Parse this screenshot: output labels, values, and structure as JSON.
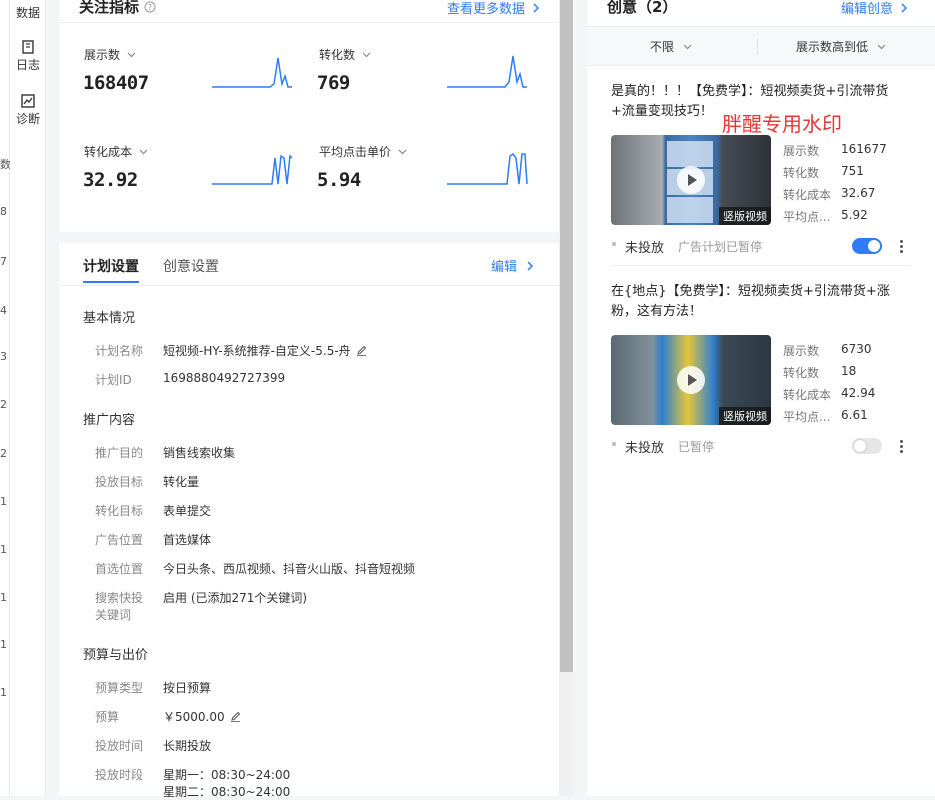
{
  "left_edge_numbers": [
    "数",
    "8",
    "7",
    "4",
    "3",
    "2",
    "2",
    "1",
    "1",
    "1",
    "1",
    "1"
  ],
  "rail": {
    "items": [
      {
        "label": "数据",
        "icon": "data-icon"
      },
      {
        "label": "日志",
        "icon": "log-icon"
      },
      {
        "label": "诊断",
        "icon": "diagnosis-icon"
      }
    ]
  },
  "metrics": {
    "title": "关注指标",
    "more_link": "查看更多数据",
    "items": [
      {
        "label": "展示数",
        "value": "168407"
      },
      {
        "label": "转化数",
        "value": "769"
      },
      {
        "label": "转化成本",
        "value": "32.92"
      },
      {
        "label": "平均点击单价",
        "value": "5.94"
      }
    ],
    "accent": "#2e7cf6"
  },
  "plan": {
    "tabs": [
      "计划设置",
      "创意设置"
    ],
    "edit": "编辑",
    "basic": {
      "title": "基本情况",
      "fields": [
        {
          "label": "计划名称",
          "value": "短视频-HY-系统推荐-自定义-5.5-舟"
        },
        {
          "label": "计划ID",
          "value": "1698880492727399"
        }
      ]
    },
    "promo": {
      "title": "推广内容",
      "fields": [
        {
          "label": "推广目的",
          "value": "销售线索收集"
        },
        {
          "label": "投放目标",
          "value": "转化量"
        },
        {
          "label": "转化目标",
          "value": "表单提交"
        },
        {
          "label": "广告位置",
          "value": "首选媒体"
        },
        {
          "label": "首选位置",
          "value": "今日头条、西瓜视频、抖音火山版、抖音短视频"
        },
        {
          "label": "搜索快投",
          "label2": "关键词",
          "value": "启用 (已添加271个关键词)"
        }
      ]
    },
    "budget": {
      "title": "预算与出价",
      "fields": [
        {
          "label": "预算类型",
          "value": "按日预算"
        },
        {
          "label": "预算",
          "value": "￥5000.00"
        },
        {
          "label": "投放时间",
          "value": "长期投放"
        },
        {
          "label": "投放时段",
          "value": "星期一：08:30~24:00",
          "value2": "星期二：08:30~24:00"
        }
      ]
    }
  },
  "creative": {
    "title": "创意（2）",
    "edit": "编辑创意",
    "filter1": "不限",
    "filter2": "展示数高到低",
    "watermark": "胖醒专用水印",
    "items": [
      {
        "title": "是真的！！！【免费学】：短视频卖货+引流带货+流量变现技巧！",
        "badge": "竖版视频",
        "stats": [
          {
            "label": "展示数",
            "value": "161677"
          },
          {
            "label": "转化数",
            "value": "751"
          },
          {
            "label": "转化成本",
            "value": "32.67"
          },
          {
            "label": "平均点...",
            "value": "5.92"
          }
        ],
        "status": "未投放",
        "sub": "广告计划已暂停",
        "enabled": true
      },
      {
        "title": "在{地点}【免费学】：短视频卖货+引流带货+涨粉，这有方法！",
        "badge": "竖版视频",
        "stats": [
          {
            "label": "展示数",
            "value": "6730"
          },
          {
            "label": "转化数",
            "value": "18"
          },
          {
            "label": "转化成本",
            "value": "42.94"
          },
          {
            "label": "平均点...",
            "value": "6.61"
          }
        ],
        "status": "未投放",
        "sub": "已暂停",
        "enabled": false
      }
    ]
  }
}
